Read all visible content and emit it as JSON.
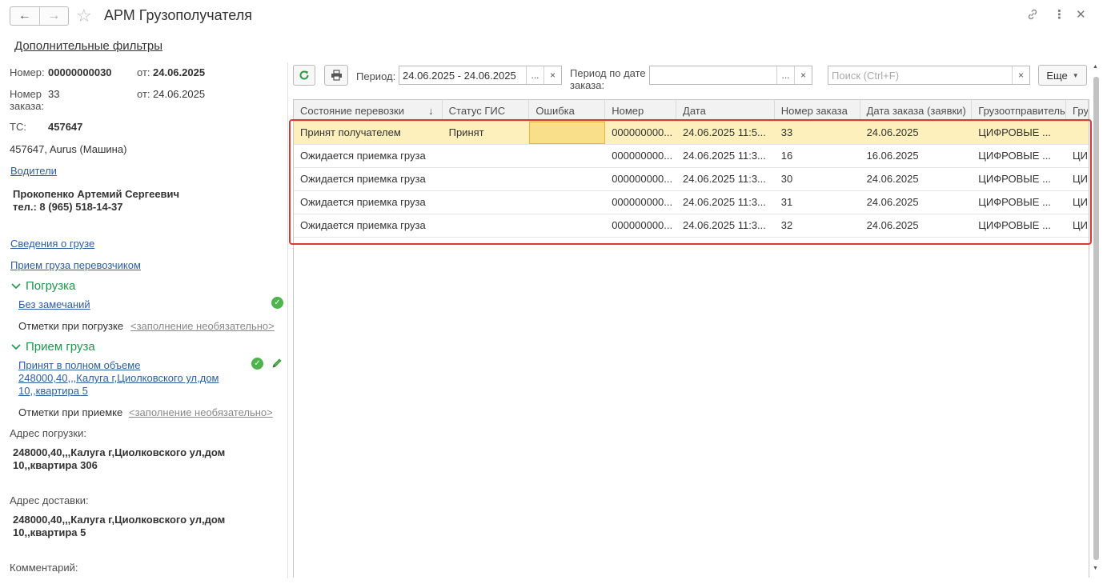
{
  "window": {
    "back_icon": "arrow-left-icon",
    "forward_icon": "arrow-right-icon",
    "title": "АРМ Грузополучателя",
    "link_icon": "link-icon",
    "menu_icon": "more-vertical-icon",
    "close_icon": "close-icon"
  },
  "left": {
    "extra_filters": "Дополнительные фильтры",
    "number_label": "Номер:",
    "number_value": "00000000030",
    "from_label": "от:",
    "date_value": "24.06.2025",
    "order_label_1": "Номер",
    "order_label_2": "заказа:",
    "order_value": "33",
    "order_from_label": "от:",
    "order_date": "24.06.2025",
    "ts_label": "ТС:",
    "ts_value": "457647",
    "vehicle": "457647, Aurus (Машина)",
    "drivers_link": "Водители",
    "driver_name": "Прокопенко Артемий Сергеевич",
    "driver_phone": "тел.: 8 (965) 518-14-37",
    "cargo_info_link": "Сведения о грузе",
    "carrier_accept_link": "Прием груза перевозчиком",
    "loading_section": "Погрузка",
    "loading_status_link": "Без замечаний",
    "loading_marks_label": "Отметки при погрузке",
    "loading_marks_hint": "<заполнение необязательно>",
    "receipt_section": "Прием груза",
    "receipt_link_1": "Принят в полном объеме",
    "receipt_link_2": "248000,40,,,Калуга г,Циолковского ул,дом",
    "receipt_link_3": "10,,квартира 5",
    "receipt_marks_label": "Отметки при приемке",
    "receipt_marks_hint": "<заполнение необязательно>",
    "load_addr_label": "Адрес погрузки:",
    "load_addr_1": "248000,40,,,Калуга г,Циолковского ул,дом",
    "load_addr_2": "10,,квартира 306",
    "deliv_addr_label": "Адрес доставки:",
    "deliv_addr_1": "248000,40,,,Калуга г,Циолковского ул,дом",
    "deliv_addr_2": "10,,квартира 5",
    "comment_label": "Комментарий:"
  },
  "toolbar": {
    "refresh_icon": "refresh-icon",
    "print_icon": "print-icon",
    "period_label": "Период:",
    "period_value": "24.06.2025 - 24.06.2025",
    "select_btn": "...",
    "clear_btn": "×",
    "order_period_label_1": "Период по дате",
    "order_period_label_2": "заказа:",
    "order_period_value": "",
    "search_placeholder": "Поиск (Ctrl+F)",
    "more_label": "Еще",
    "dropdown_icon": "caret-down-icon"
  },
  "table": {
    "columns": [
      "Состояние перевозки",
      "Статус ГИС",
      "Ошибка",
      "Номер",
      "Дата",
      "Номер заказа",
      "Дата заказа (заявки)",
      "Грузоотправитель",
      "Гру"
    ],
    "sort_icon": "↓",
    "rows": [
      [
        "Принят получателем",
        "Принят",
        "",
        "000000000...",
        "24.06.2025 11:5...",
        "33",
        "24.06.2025",
        "ЦИФРОВЫЕ ...",
        ""
      ],
      [
        "Ожидается приемка груза",
        "",
        "",
        "000000000...",
        "24.06.2025 11:3...",
        "16",
        "16.06.2025",
        "ЦИФРОВЫЕ ...",
        "ЦИ"
      ],
      [
        "Ожидается приемка груза",
        "",
        "",
        "000000000...",
        "24.06.2025 11:3...",
        "30",
        "24.06.2025",
        "ЦИФРОВЫЕ ...",
        "ЦИ"
      ],
      [
        "Ожидается приемка груза",
        "",
        "",
        "000000000...",
        "24.06.2025 11:3...",
        "31",
        "24.06.2025",
        "ЦИФРОВЫЕ ...",
        "ЦИ"
      ],
      [
        "Ожидается приемка груза",
        "",
        "",
        "000000000...",
        "24.06.2025 11:3...",
        "32",
        "24.06.2025",
        "ЦИФРОВЫЕ ...",
        "ЦИ"
      ]
    ]
  },
  "colors": {
    "accent_green": "#1a9a4b",
    "link_blue": "#2b5ea7",
    "highlight_red": "#d93a33",
    "selected_row": "#fdf0bd"
  }
}
